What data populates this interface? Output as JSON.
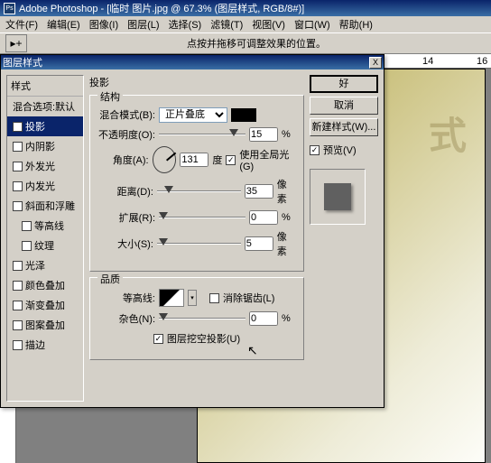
{
  "app": {
    "title": "Adobe Photoshop - [临时 图片.jpg @ 67.3% (图层样式, RGB/8#)]",
    "ps": "Ps"
  },
  "menu": {
    "file": "文件(F)",
    "edit": "编辑(E)",
    "image": "图像(I)",
    "layer": "图层(L)",
    "select": "选择(S)",
    "filter": "滤镜(T)",
    "view": "视图(V)",
    "window": "窗口(W)",
    "help": "帮助(H)"
  },
  "opt": {
    "tool": "▸+",
    "hint": "点按并拖移可调整效果的位置。"
  },
  "ruler": {
    "r14": "14",
    "r16": "16"
  },
  "watermark": "式",
  "dlg": {
    "title": "图层样式",
    "close": "X",
    "list": {
      "hdr": "样式",
      "blend": "混合选项:默认",
      "drop": "投影",
      "inner": "内阴影",
      "outerglow": "外发光",
      "innerglow": "内发光",
      "bevel": "斜面和浮雕",
      "contour_i": "等高线",
      "texture": "纹理",
      "satin": "光泽",
      "coloroverlay": "颜色叠加",
      "gradoverlay": "渐变叠加",
      "patoverlay": "图案叠加",
      "stroke": "描边"
    },
    "main": {
      "title": "投影",
      "struct": "结构",
      "blendmode": {
        "lbl": "混合模式(B):",
        "val": "正片叠底"
      },
      "opacity": {
        "lbl": "不透明度(O):",
        "val": "15",
        "unit": "%"
      },
      "angle": {
        "lbl": "角度(A):",
        "val": "131",
        "unit": "度",
        "global": "使用全局光(G)"
      },
      "distance": {
        "lbl": "距离(D):",
        "val": "35",
        "unit": "像素"
      },
      "spread": {
        "lbl": "扩展(R):",
        "val": "0",
        "unit": "%"
      },
      "size": {
        "lbl": "大小(S):",
        "val": "5",
        "unit": "像素"
      },
      "quality": "品质",
      "contour": {
        "lbl": "等高线:",
        "anti": "消除锯齿(L)"
      },
      "noise": {
        "lbl": "杂色(N):",
        "val": "0",
        "unit": "%"
      },
      "knock": "图层挖空投影(U)"
    },
    "btns": {
      "ok": "好",
      "cancel": "取消",
      "new": "新建样式(W)...",
      "preview": "预览(V)"
    }
  },
  "check": "✓",
  "dd": "▾"
}
